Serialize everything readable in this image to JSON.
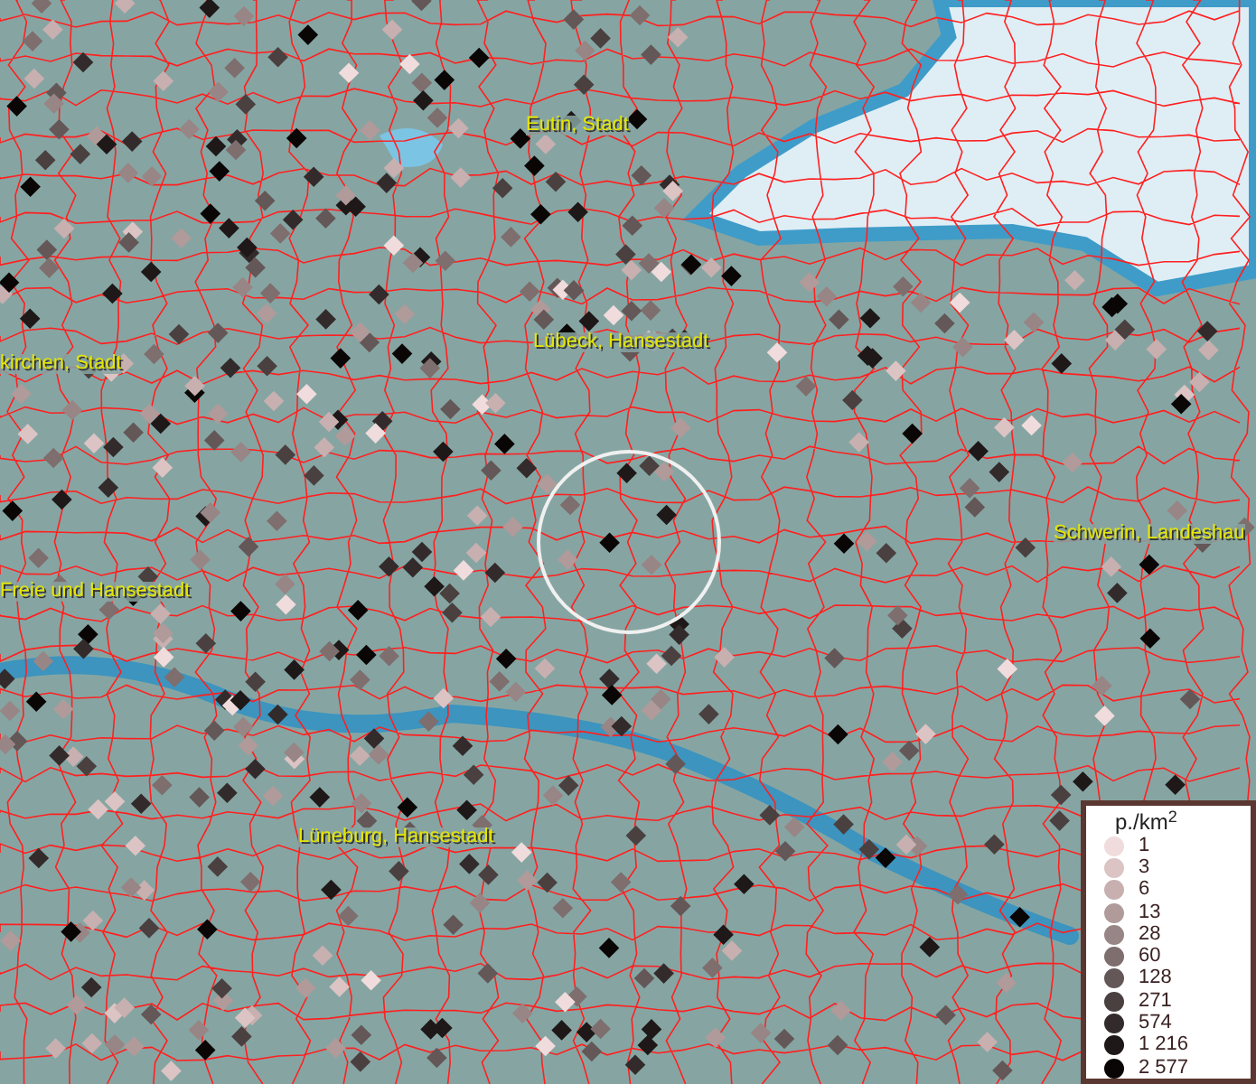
{
  "map": {
    "place_labels": [
      {
        "text": "Eutin, Stadt"
      },
      {
        "text": "Lübeck, Hansestadt"
      },
      {
        "text": "kirchen, Stadt"
      },
      {
        "text": "Freie und Hansestadt"
      },
      {
        "text": "Schwerin, Landeshau"
      },
      {
        "text": "Lüneburg, Hansestadt"
      }
    ]
  },
  "legend": {
    "title": "p./km$^{2}$",
    "entries": [
      {
        "label": "1",
        "color": "#f0dcdc"
      },
      {
        "label": "3",
        "color": "#dcc4c4"
      },
      {
        "label": "6",
        "color": "#c8b0b0"
      },
      {
        "label": "13",
        "color": "#b09a9a"
      },
      {
        "label": "28",
        "color": "#988585"
      },
      {
        "label": "60",
        "color": "#7e6e6e"
      },
      {
        "label": "128",
        "color": "#645757"
      },
      {
        "label": "271",
        "color": "#4a4040"
      },
      {
        "label": "574",
        "color": "#332b2b"
      },
      {
        "label": "1 216",
        "color": "#1e1818"
      },
      {
        "label": "2 577",
        "color": "#0a0606"
      }
    ]
  }
}
